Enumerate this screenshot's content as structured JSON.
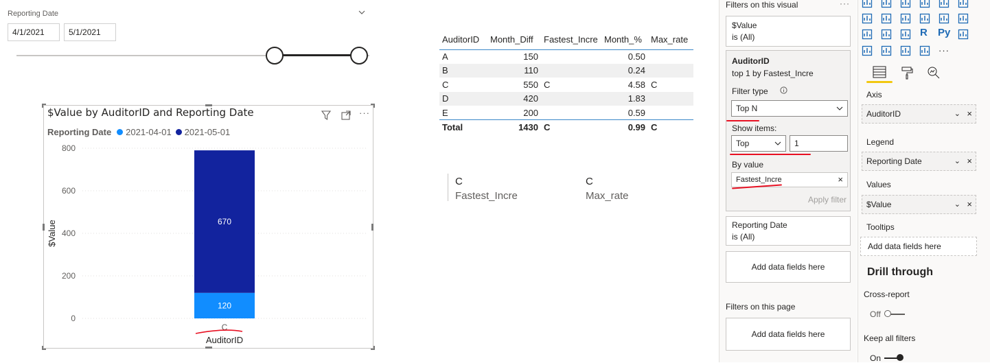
{
  "slicer": {
    "title": "Reporting Date",
    "start_date": "4/1/2021",
    "end_date": "5/1/2021",
    "range_selected": [
      0.73,
      0.97
    ]
  },
  "chart": {
    "title": "$Value by AuditorID and Reporting Date",
    "legend_title": "Reporting Date",
    "legend_items": [
      {
        "label": "2021-04-01",
        "color": "#118dff"
      },
      {
        "label": "2021-05-01",
        "color": "#12239e"
      }
    ]
  },
  "chart_data": {
    "type": "bar",
    "stacked": true,
    "title": "$Value by AuditorID and Reporting Date",
    "xlabel": "AuditorID",
    "ylabel": "$Value",
    "categories": [
      "C"
    ],
    "yticks": [
      "0",
      "200",
      "400",
      "600",
      "800"
    ],
    "ylim": [
      0,
      800
    ],
    "grid": true,
    "legend_position": "top-left",
    "series": [
      {
        "name": "2021-04-01",
        "values": [
          120
        ],
        "labels": [
          "120"
        ],
        "color": "#118dff"
      },
      {
        "name": "2021-05-01",
        "values": [
          670
        ],
        "labels": [
          "670"
        ],
        "color": "#12239e"
      }
    ]
  },
  "matrix": {
    "headers": [
      "AuditorID",
      "Month_Diff",
      "Fastest_Incre",
      "Month_%",
      "Max_rate"
    ],
    "rows": [
      [
        "A",
        "150",
        "",
        "0.50",
        ""
      ],
      [
        "B",
        "110",
        "",
        "0.24",
        ""
      ],
      [
        "C",
        "550",
        "C",
        "4.58",
        "C"
      ],
      [
        "D",
        "420",
        "",
        "1.83",
        ""
      ],
      [
        "E",
        "200",
        "",
        "0.59",
        ""
      ]
    ],
    "total": [
      "Total",
      "1430",
      "C",
      "0.99",
      "C"
    ]
  },
  "cards": [
    {
      "value": "C",
      "label": "Fastest_Incre"
    },
    {
      "value": "C",
      "label": "Max_rate"
    }
  ],
  "filters": {
    "visual_header": "Filters on this visual",
    "more": "···",
    "value_filter": {
      "name": "$Value",
      "state": "is (All)"
    },
    "auditor": {
      "name": "AuditorID",
      "summary": "top 1 by Fastest_Incre",
      "filter_type_label": "Filter type",
      "filter_type": "Top N",
      "show_items_label": "Show items:",
      "show_direction": "Top",
      "show_count": "1",
      "by_value_label": "By value",
      "by_value_field": "Fastest_Incre",
      "apply": "Apply filter"
    },
    "date_filter": {
      "name": "Reporting Date",
      "state": "is (All)"
    },
    "add_fields": "Add data fields here",
    "page_header": "Filters on this page",
    "page_add_fields": "Add data fields here"
  },
  "visualizations": {
    "py_label": "Py",
    "r_label": "R",
    "more": "···",
    "wells": [
      {
        "label": "Axis",
        "field": "AuditorID"
      },
      {
        "label": "Legend",
        "field": "Reporting Date"
      },
      {
        "label": "Values",
        "field": "$Value"
      }
    ],
    "tooltips_label": "Tooltips",
    "tooltips_placeholder": "Add data fields here",
    "drill_through": "Drill through",
    "cross_report": "Cross-report",
    "cross_report_state": "Off",
    "keep_filters": "Keep all filters",
    "keep_filters_state": "On",
    "accent": "#f2c811"
  }
}
